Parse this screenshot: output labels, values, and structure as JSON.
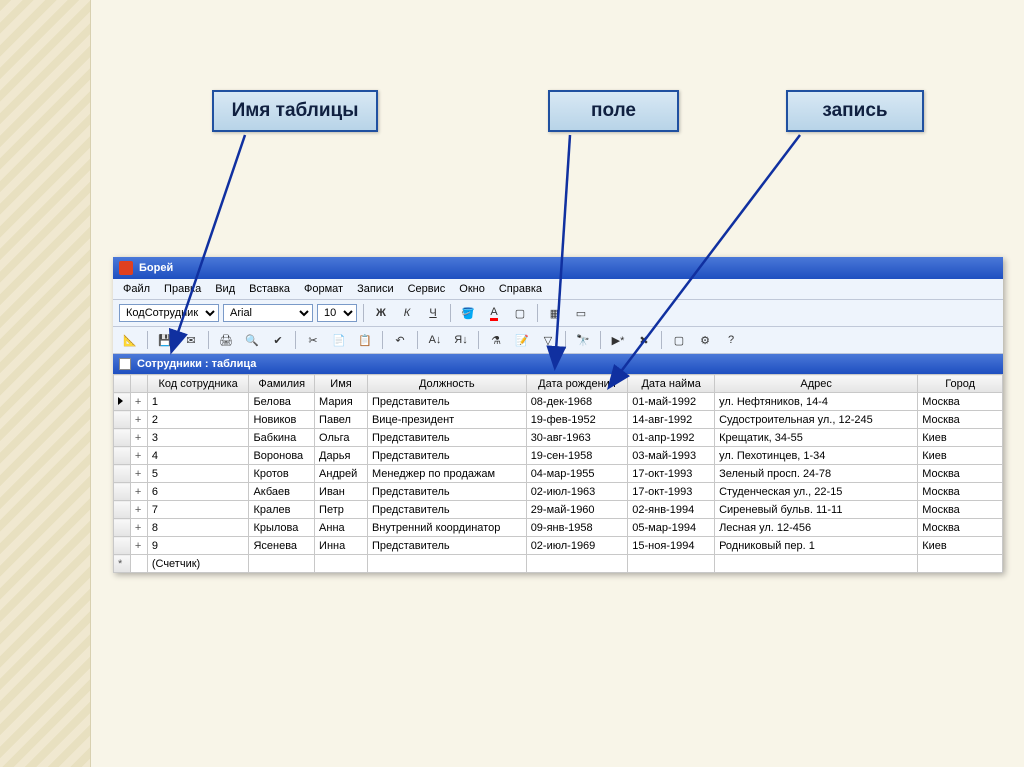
{
  "callouts": {
    "c1": "Имя таблицы",
    "c2": "поле",
    "c3": "запись"
  },
  "app": {
    "title": "Борей",
    "menus": [
      "Файл",
      "Правка",
      "Вид",
      "Вставка",
      "Формат",
      "Записи",
      "Сервис",
      "Окно",
      "Справка"
    ],
    "field_combo": "КодСотрудник",
    "font_combo": "Arial",
    "size_combo": "10",
    "subwindow_title": "Сотрудники : таблица"
  },
  "table": {
    "columns": [
      "Код сотрудника",
      "Фамилия",
      "Имя",
      "Должность",
      "Дата рождения",
      "Дата найма",
      "Адрес",
      "Город"
    ],
    "rows": [
      {
        "id": "1",
        "fam": "Белова",
        "name": "Мария",
        "pos": "Представитель",
        "dob": "08-дек-1968",
        "hired": "01-май-1992",
        "addr": "ул. Нефтяников, 14-4",
        "city": "Москва"
      },
      {
        "id": "2",
        "fam": "Новиков",
        "name": "Павел",
        "pos": "Вице-президент",
        "dob": "19-фев-1952",
        "hired": "14-авг-1992",
        "addr": "Судостроительная ул., 12-245",
        "city": "Москва"
      },
      {
        "id": "3",
        "fam": "Бабкина",
        "name": "Ольга",
        "pos": "Представитель",
        "dob": "30-авг-1963",
        "hired": "01-апр-1992",
        "addr": "Крещатик, 34-55",
        "city": "Киев"
      },
      {
        "id": "4",
        "fam": "Воронова",
        "name": "Дарья",
        "pos": "Представитель",
        "dob": "19-сен-1958",
        "hired": "03-май-1993",
        "addr": "ул. Пехотинцев, 1-34",
        "city": "Киев"
      },
      {
        "id": "5",
        "fam": "Кротов",
        "name": "Андрей",
        "pos": "Менеджер по продажам",
        "dob": "04-мар-1955",
        "hired": "17-окт-1993",
        "addr": "Зеленый просп. 24-78",
        "city": "Москва"
      },
      {
        "id": "6",
        "fam": "Акбаев",
        "name": "Иван",
        "pos": "Представитель",
        "dob": "02-июл-1963",
        "hired": "17-окт-1993",
        "addr": "Студенческая ул., 22-15",
        "city": "Москва"
      },
      {
        "id": "7",
        "fam": "Кралев",
        "name": "Петр",
        "pos": "Представитель",
        "dob": "29-май-1960",
        "hired": "02-янв-1994",
        "addr": "Сиреневый бульв. 11-11",
        "city": "Москва"
      },
      {
        "id": "8",
        "fam": "Крылова",
        "name": "Анна",
        "pos": "Внутренний координатор",
        "dob": "09-янв-1958",
        "hired": "05-мар-1994",
        "addr": "Лесная ул. 12-456",
        "city": "Москва"
      },
      {
        "id": "9",
        "fam": "Ясенева",
        "name": "Инна",
        "pos": "Представитель",
        "dob": "02-июл-1969",
        "hired": "15-ноя-1994",
        "addr": "Родниковый пер. 1",
        "city": "Киев"
      }
    ],
    "counter": "(Счетчик)"
  }
}
